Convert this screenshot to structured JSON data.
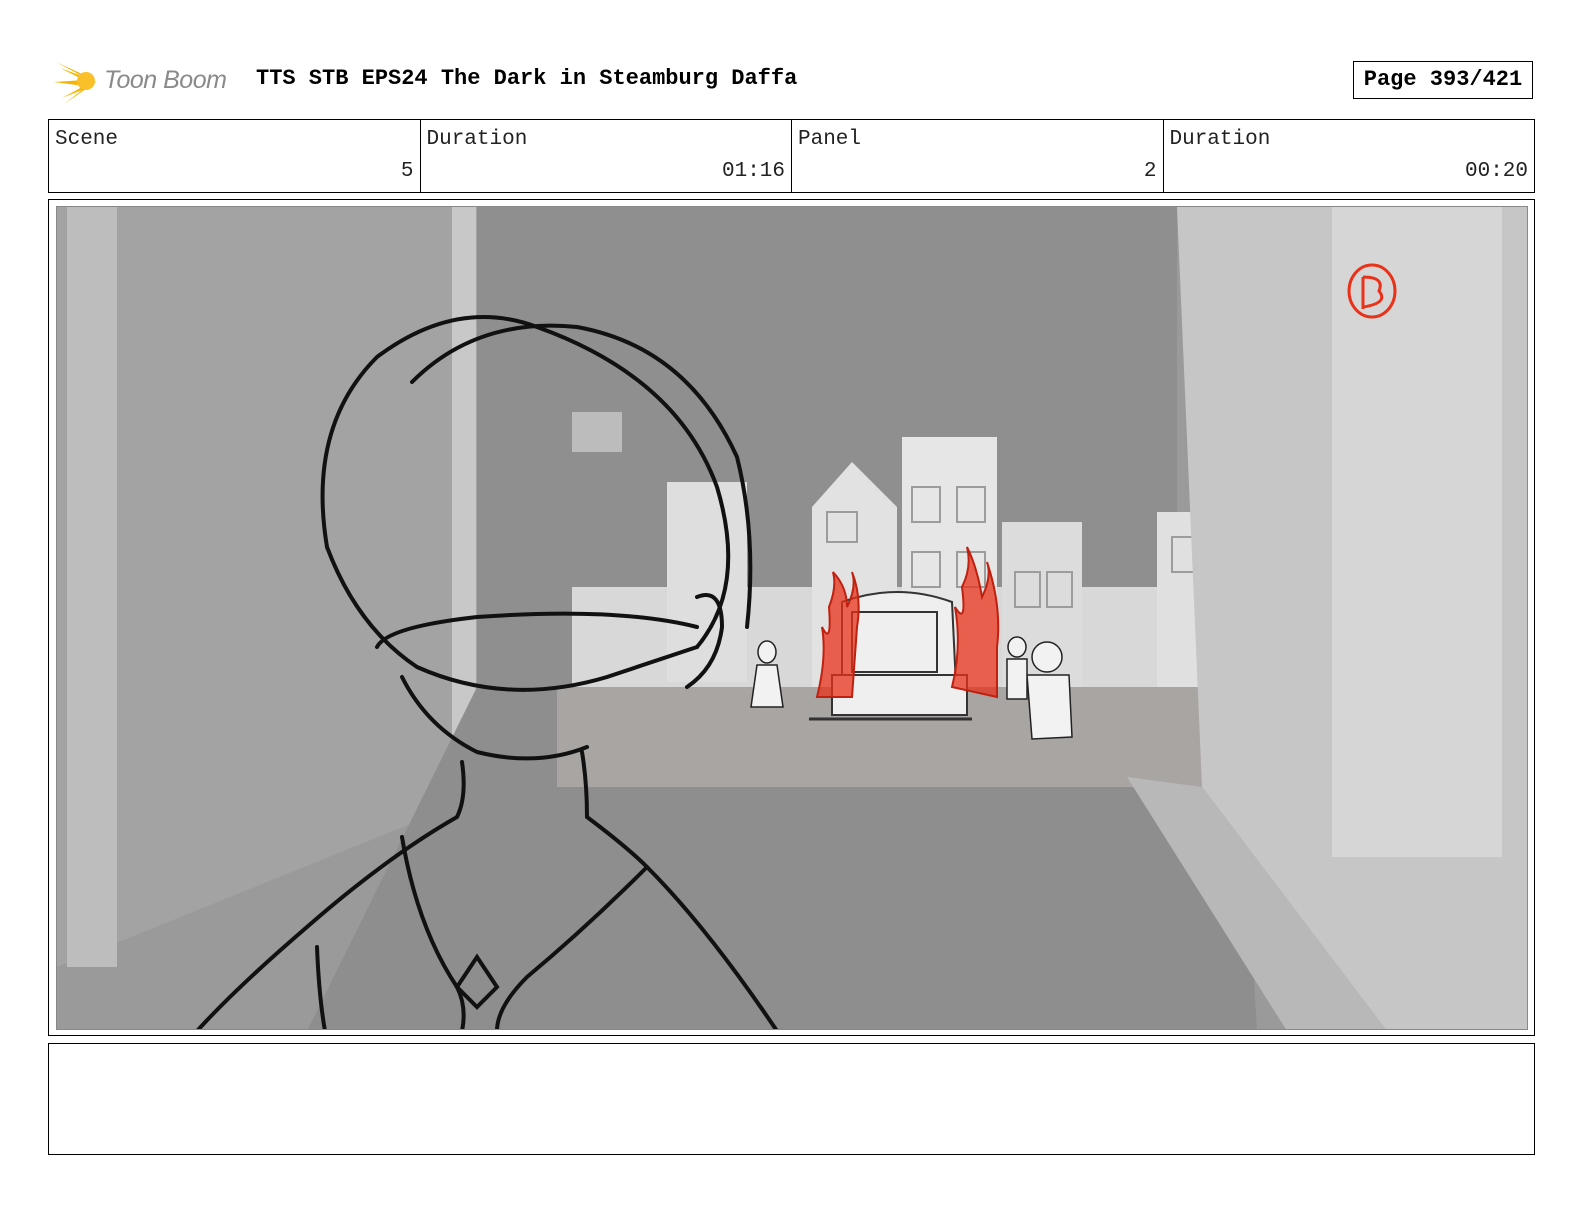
{
  "header": {
    "logo_text": "Toon Boom",
    "title": "TTS STB EPS24 The Dark in Steamburg Daffa",
    "page": "Page 393/421"
  },
  "info": {
    "scene_label": "Scene",
    "scene_value": "5",
    "scene_duration_label": "Duration",
    "scene_duration_value": "01:16",
    "panel_label": "Panel",
    "panel_value": "2",
    "panel_duration_label": "Duration",
    "panel_duration_value": "00:20"
  },
  "colors": {
    "logo_yellow": "#f7b500",
    "fire_red": "#e8321a",
    "sketch_line": "#111111"
  },
  "panel_art": {
    "marker_letter": "B"
  },
  "notes": ""
}
